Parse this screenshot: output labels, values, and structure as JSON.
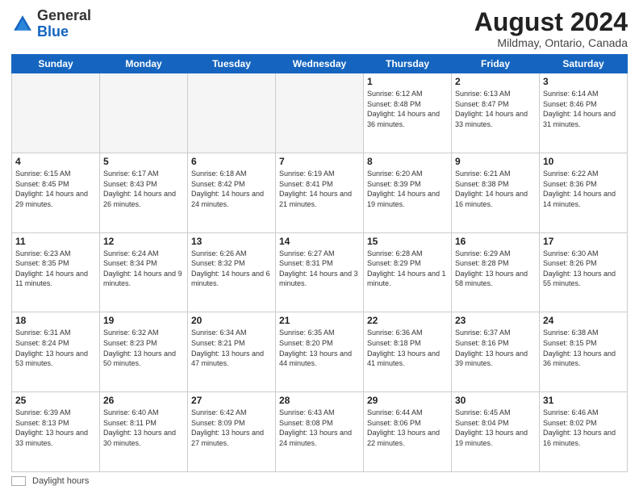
{
  "logo": {
    "line1": "General",
    "line2": "Blue"
  },
  "title": "August 2024",
  "subtitle": "Mildmay, Ontario, Canada",
  "days_of_week": [
    "Sunday",
    "Monday",
    "Tuesday",
    "Wednesday",
    "Thursday",
    "Friday",
    "Saturday"
  ],
  "legend_label": "Daylight hours",
  "weeks": [
    [
      {
        "day": "",
        "info": ""
      },
      {
        "day": "",
        "info": ""
      },
      {
        "day": "",
        "info": ""
      },
      {
        "day": "",
        "info": ""
      },
      {
        "day": "1",
        "info": "Sunrise: 6:12 AM\nSunset: 8:48 PM\nDaylight: 14 hours and 36 minutes."
      },
      {
        "day": "2",
        "info": "Sunrise: 6:13 AM\nSunset: 8:47 PM\nDaylight: 14 hours and 33 minutes."
      },
      {
        "day": "3",
        "info": "Sunrise: 6:14 AM\nSunset: 8:46 PM\nDaylight: 14 hours and 31 minutes."
      }
    ],
    [
      {
        "day": "4",
        "info": "Sunrise: 6:15 AM\nSunset: 8:45 PM\nDaylight: 14 hours and 29 minutes."
      },
      {
        "day": "5",
        "info": "Sunrise: 6:17 AM\nSunset: 8:43 PM\nDaylight: 14 hours and 26 minutes."
      },
      {
        "day": "6",
        "info": "Sunrise: 6:18 AM\nSunset: 8:42 PM\nDaylight: 14 hours and 24 minutes."
      },
      {
        "day": "7",
        "info": "Sunrise: 6:19 AM\nSunset: 8:41 PM\nDaylight: 14 hours and 21 minutes."
      },
      {
        "day": "8",
        "info": "Sunrise: 6:20 AM\nSunset: 8:39 PM\nDaylight: 14 hours and 19 minutes."
      },
      {
        "day": "9",
        "info": "Sunrise: 6:21 AM\nSunset: 8:38 PM\nDaylight: 14 hours and 16 minutes."
      },
      {
        "day": "10",
        "info": "Sunrise: 6:22 AM\nSunset: 8:36 PM\nDaylight: 14 hours and 14 minutes."
      }
    ],
    [
      {
        "day": "11",
        "info": "Sunrise: 6:23 AM\nSunset: 8:35 PM\nDaylight: 14 hours and 11 minutes."
      },
      {
        "day": "12",
        "info": "Sunrise: 6:24 AM\nSunset: 8:34 PM\nDaylight: 14 hours and 9 minutes."
      },
      {
        "day": "13",
        "info": "Sunrise: 6:26 AM\nSunset: 8:32 PM\nDaylight: 14 hours and 6 minutes."
      },
      {
        "day": "14",
        "info": "Sunrise: 6:27 AM\nSunset: 8:31 PM\nDaylight: 14 hours and 3 minutes."
      },
      {
        "day": "15",
        "info": "Sunrise: 6:28 AM\nSunset: 8:29 PM\nDaylight: 14 hours and 1 minute."
      },
      {
        "day": "16",
        "info": "Sunrise: 6:29 AM\nSunset: 8:28 PM\nDaylight: 13 hours and 58 minutes."
      },
      {
        "day": "17",
        "info": "Sunrise: 6:30 AM\nSunset: 8:26 PM\nDaylight: 13 hours and 55 minutes."
      }
    ],
    [
      {
        "day": "18",
        "info": "Sunrise: 6:31 AM\nSunset: 8:24 PM\nDaylight: 13 hours and 53 minutes."
      },
      {
        "day": "19",
        "info": "Sunrise: 6:32 AM\nSunset: 8:23 PM\nDaylight: 13 hours and 50 minutes."
      },
      {
        "day": "20",
        "info": "Sunrise: 6:34 AM\nSunset: 8:21 PM\nDaylight: 13 hours and 47 minutes."
      },
      {
        "day": "21",
        "info": "Sunrise: 6:35 AM\nSunset: 8:20 PM\nDaylight: 13 hours and 44 minutes."
      },
      {
        "day": "22",
        "info": "Sunrise: 6:36 AM\nSunset: 8:18 PM\nDaylight: 13 hours and 41 minutes."
      },
      {
        "day": "23",
        "info": "Sunrise: 6:37 AM\nSunset: 8:16 PM\nDaylight: 13 hours and 39 minutes."
      },
      {
        "day": "24",
        "info": "Sunrise: 6:38 AM\nSunset: 8:15 PM\nDaylight: 13 hours and 36 minutes."
      }
    ],
    [
      {
        "day": "25",
        "info": "Sunrise: 6:39 AM\nSunset: 8:13 PM\nDaylight: 13 hours and 33 minutes."
      },
      {
        "day": "26",
        "info": "Sunrise: 6:40 AM\nSunset: 8:11 PM\nDaylight: 13 hours and 30 minutes."
      },
      {
        "day": "27",
        "info": "Sunrise: 6:42 AM\nSunset: 8:09 PM\nDaylight: 13 hours and 27 minutes."
      },
      {
        "day": "28",
        "info": "Sunrise: 6:43 AM\nSunset: 8:08 PM\nDaylight: 13 hours and 24 minutes."
      },
      {
        "day": "29",
        "info": "Sunrise: 6:44 AM\nSunset: 8:06 PM\nDaylight: 13 hours and 22 minutes."
      },
      {
        "day": "30",
        "info": "Sunrise: 6:45 AM\nSunset: 8:04 PM\nDaylight: 13 hours and 19 minutes."
      },
      {
        "day": "31",
        "info": "Sunrise: 6:46 AM\nSunset: 8:02 PM\nDaylight: 13 hours and 16 minutes."
      }
    ]
  ]
}
